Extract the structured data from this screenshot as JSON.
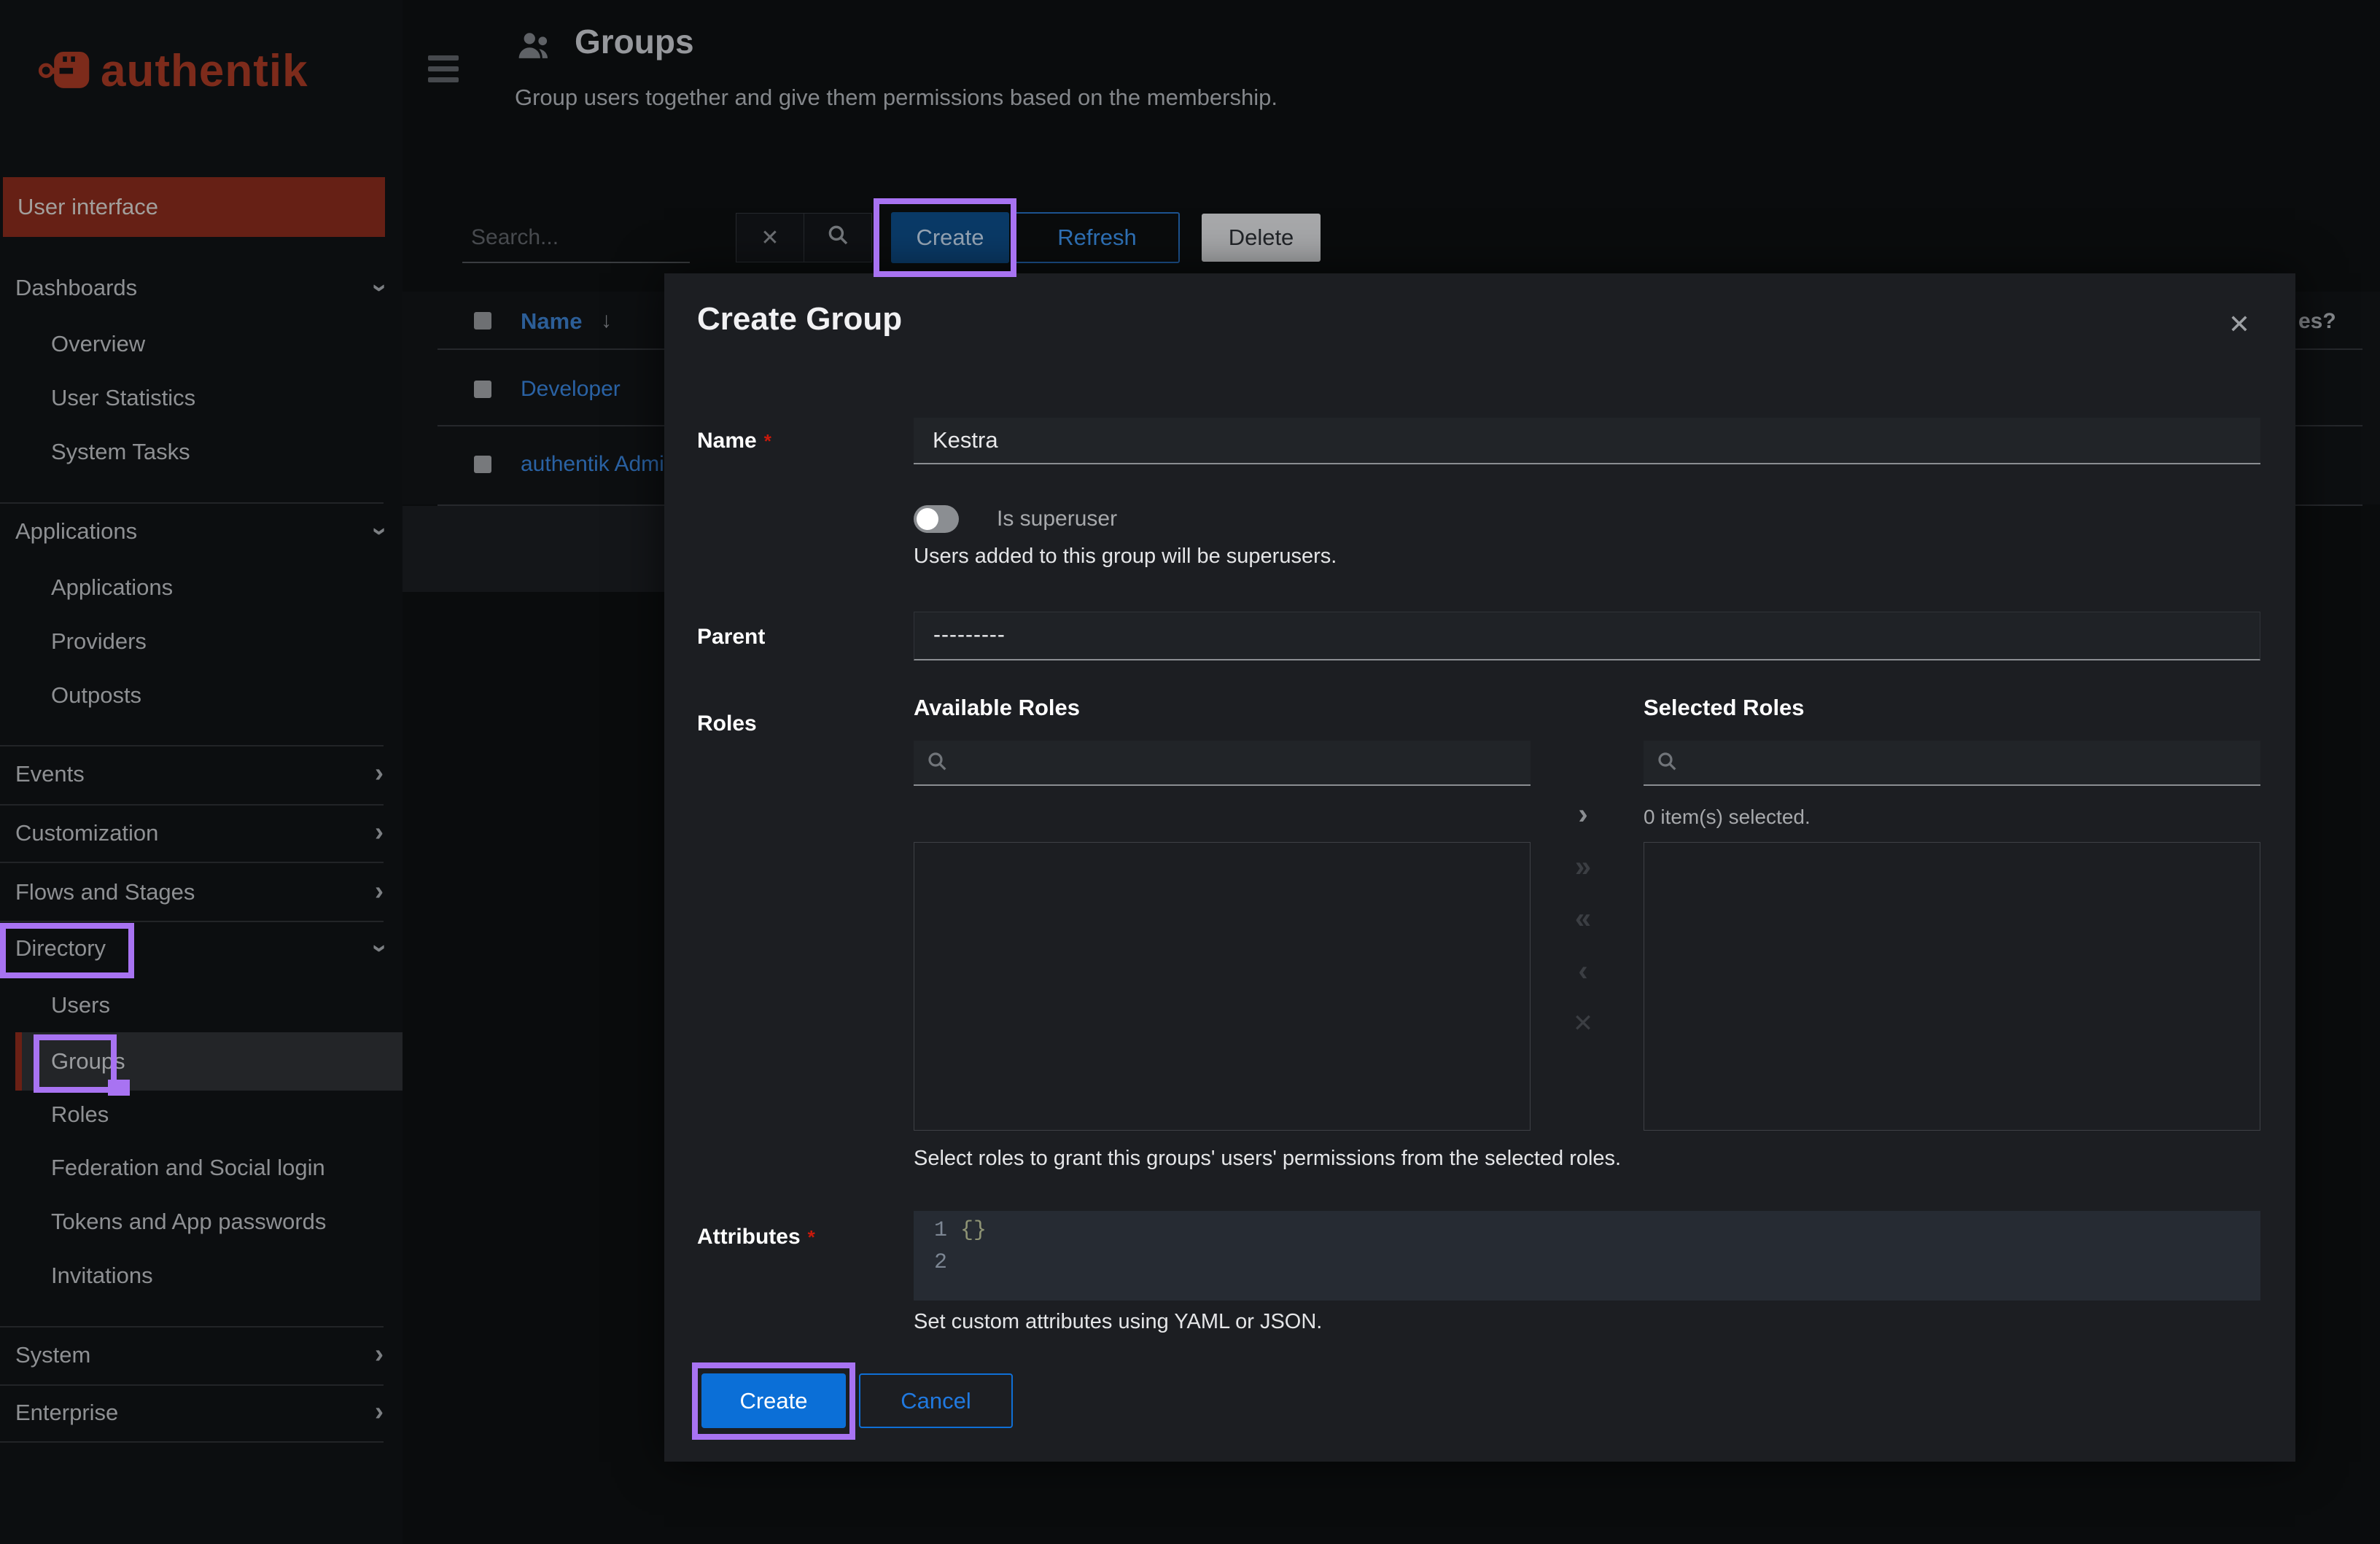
{
  "colors": {
    "brand_red": "#7d2b1b",
    "banner_red": "#662015",
    "accent_blue": "#0b6fd7",
    "annotation_purple": "#a873f2",
    "danger_red": "#c9190b"
  },
  "brand": {
    "logo_text": "authentik"
  },
  "sidebar": {
    "banner": "User interface",
    "dashboards": {
      "label": "Dashboards",
      "children": [
        "Overview",
        "User Statistics",
        "System Tasks"
      ]
    },
    "applications": {
      "label": "Applications",
      "children": [
        "Applications",
        "Providers",
        "Outposts"
      ]
    },
    "events": {
      "label": "Events"
    },
    "customization": {
      "label": "Customization"
    },
    "flows": {
      "label": "Flows and Stages"
    },
    "directory": {
      "label": "Directory",
      "children": [
        "Users",
        "Groups",
        "Roles",
        "Federation and Social login",
        "Tokens and App passwords",
        "Invitations"
      ]
    },
    "system": {
      "label": "System"
    },
    "enterprise": {
      "label": "Enterprise"
    }
  },
  "header": {
    "title": "Groups",
    "subtitle": "Group users together and give them permissions based on the membership."
  },
  "toolbar": {
    "search_placeholder": "Search...",
    "clear": "✕",
    "create": "Create",
    "refresh": "Refresh",
    "delete": "Delete"
  },
  "table": {
    "name_header": "Name",
    "sort_icon": "↓",
    "clipped_header": "es?",
    "rows": [
      "Developer",
      "authentik Admin"
    ]
  },
  "modal": {
    "title": "Create Group",
    "close": "✕",
    "name": {
      "label": "Name",
      "required_marker": "*",
      "value": "Kestra"
    },
    "superuser": {
      "label": "Is superuser",
      "enabled": false,
      "help": "Users added to this group will be superusers."
    },
    "parent": {
      "label": "Parent",
      "value": "---------"
    },
    "roles": {
      "label": "Roles",
      "available_title": "Available Roles",
      "selected_title": "Selected Roles",
      "selected_count": "0 item(s) selected.",
      "transfer": [
        "›",
        "»",
        "«",
        "‹",
        "✕"
      ],
      "help": "Select roles to grant this groups' users' permissions from the selected roles."
    },
    "attributes": {
      "label": "Attributes",
      "required_marker": "*",
      "line_numbers": [
        "1",
        "2"
      ],
      "code": "{}",
      "help": "Set custom attributes using YAML or JSON."
    },
    "actions": {
      "create": "Create",
      "cancel": "Cancel"
    }
  }
}
